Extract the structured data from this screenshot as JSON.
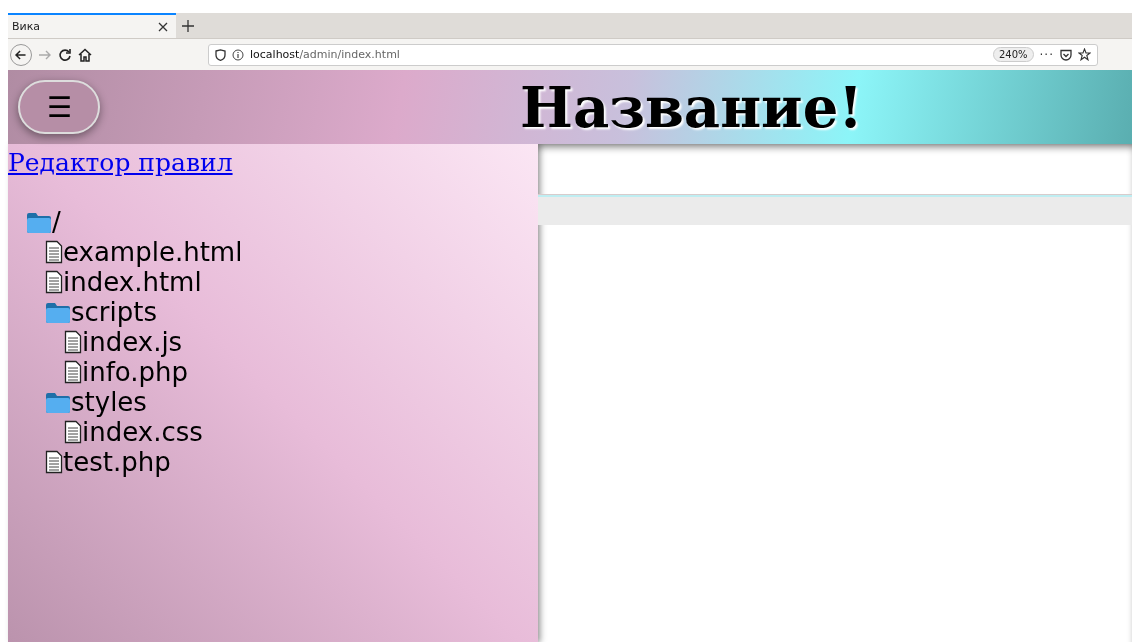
{
  "browser": {
    "tab": {
      "title": "Вика",
      "selected": true
    },
    "url_host": "localhost",
    "url_path": "/admin/index.html",
    "zoom": "240%",
    "menu_glyph": "···"
  },
  "header": {
    "menu_glyph": "☰",
    "title": "Название!"
  },
  "sidebar": {
    "link": "Редактор правил",
    "tree": [
      {
        "kind": "folder",
        "name": "/",
        "children": [
          {
            "kind": "file",
            "name": "example.html"
          },
          {
            "kind": "file",
            "name": "index.html"
          },
          {
            "kind": "folder",
            "name": "scripts",
            "children": [
              {
                "kind": "file",
                "name": "index.js"
              },
              {
                "kind": "file",
                "name": "info.php"
              }
            ]
          },
          {
            "kind": "folder",
            "name": "styles",
            "children": [
              {
                "kind": "file",
                "name": "index.css"
              }
            ]
          },
          {
            "kind": "file",
            "name": "test.php"
          }
        ]
      }
    ]
  }
}
